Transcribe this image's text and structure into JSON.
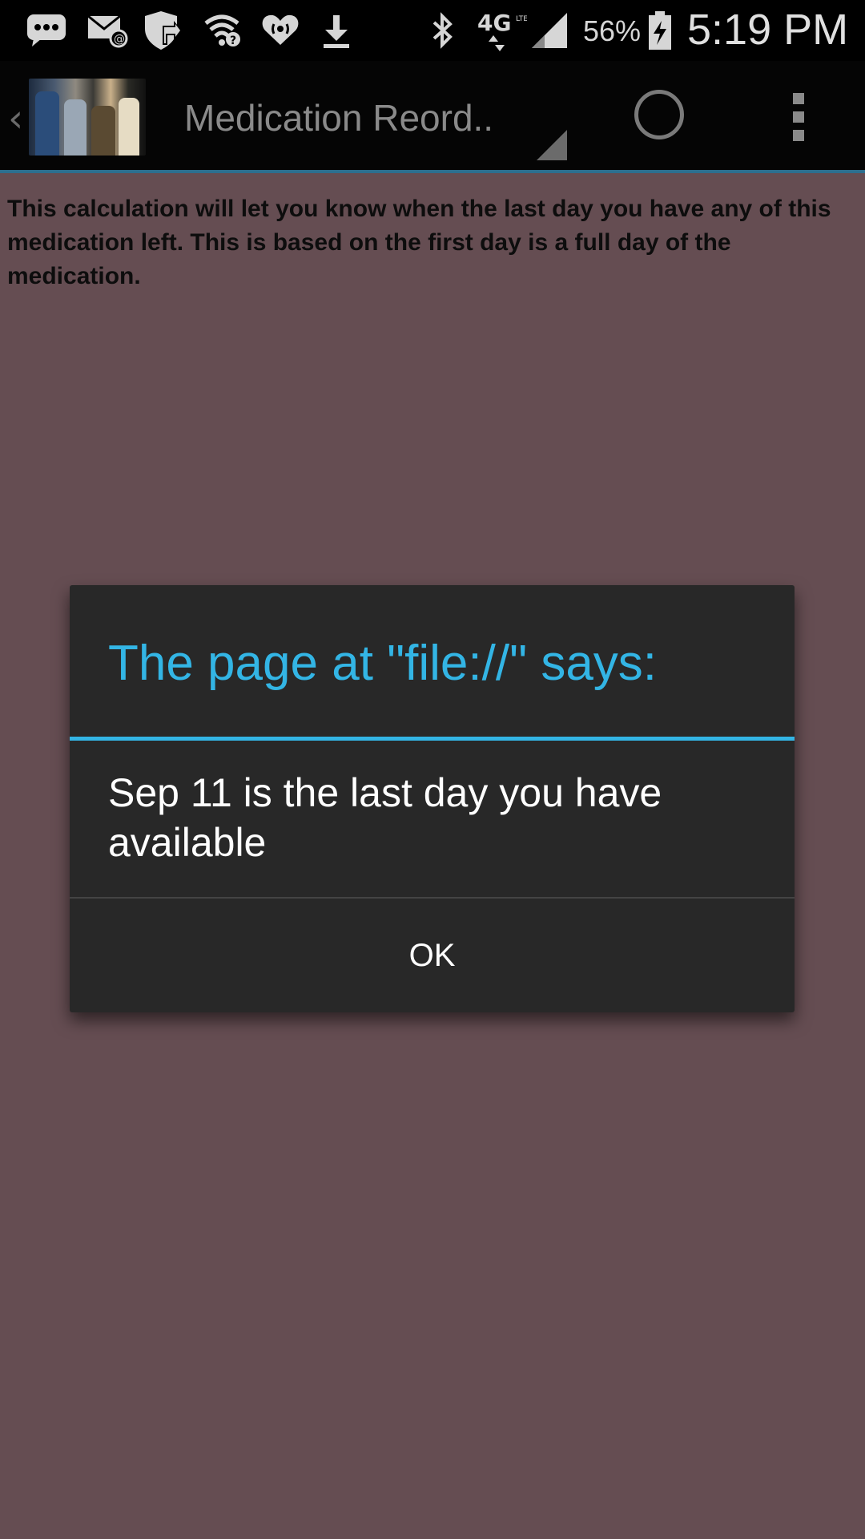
{
  "status_bar": {
    "icons": [
      "chat-icon",
      "email-icon",
      "shield-icon",
      "wifi-icon",
      "iheart-icon",
      "download-icon",
      "bluetooth-icon",
      "4g-lte-icon",
      "signal-icon",
      "battery-icon"
    ],
    "network_label": "4G",
    "battery_percent": "56%",
    "time": "5:19 PM"
  },
  "action_bar": {
    "back_glyph": "‹",
    "title": "Medication Reord.."
  },
  "content": {
    "info_text": "This calculation will let you know when the last day you have any of this medication left. This is based on the first day is a full day of the medication."
  },
  "dialog": {
    "title": "The page at \"file://\" says:",
    "message": "Sep 11 is the last day you have available",
    "ok_label": "OK",
    "accent_color": "#33b5e5"
  },
  "colors": {
    "page_background": "#654d52",
    "action_bar_underline": "#2c6f8f"
  }
}
